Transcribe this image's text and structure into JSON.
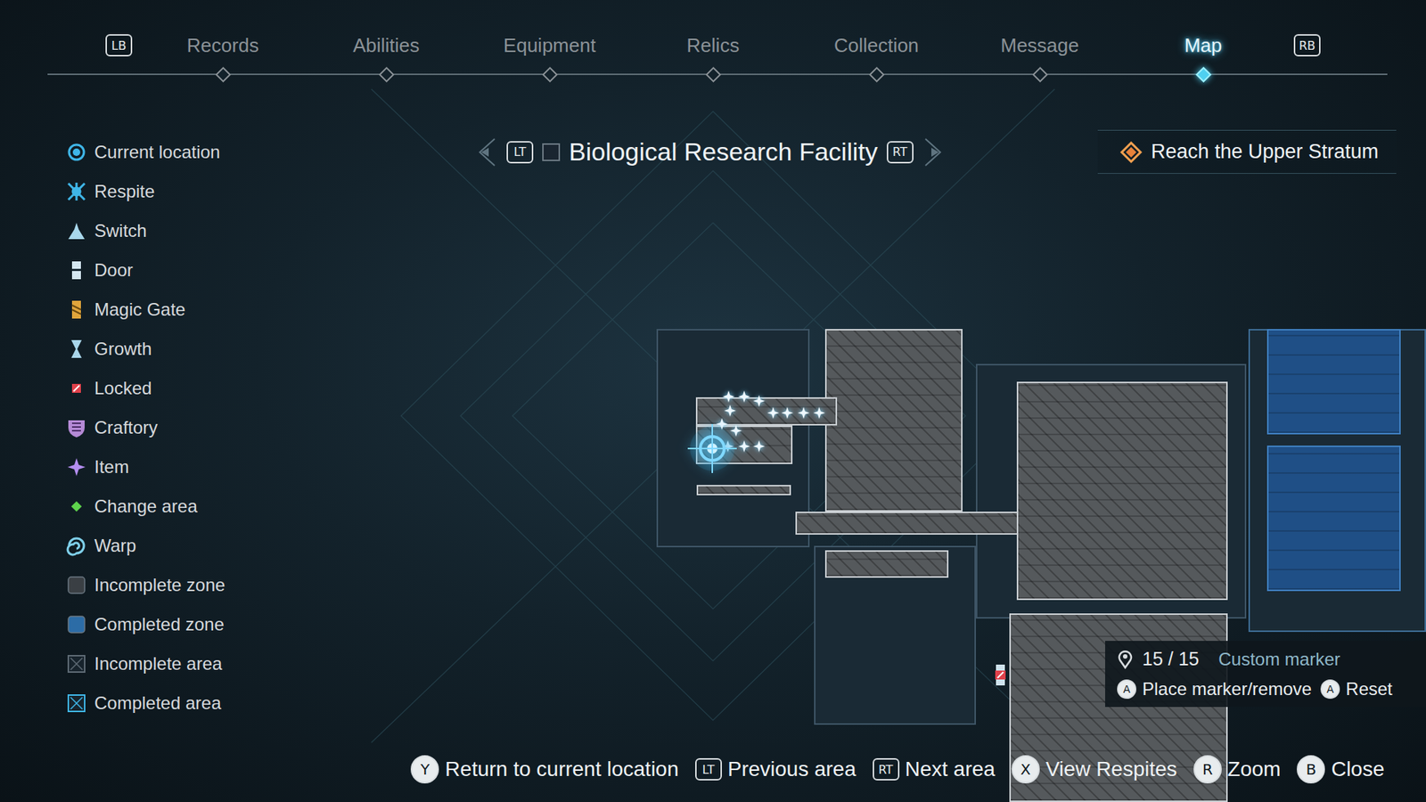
{
  "nav": {
    "prev_key": "LB",
    "next_key": "RB",
    "tabs": [
      {
        "label": "Records",
        "selected": false
      },
      {
        "label": "Abilities",
        "selected": false
      },
      {
        "label": "Equipment",
        "selected": false
      },
      {
        "label": "Relics",
        "selected": false
      },
      {
        "label": "Collection",
        "selected": false
      },
      {
        "label": "Message",
        "selected": false
      },
      {
        "label": "Map",
        "selected": true
      }
    ]
  },
  "legend": [
    {
      "label": "Current location",
      "kind": "current",
      "color": "#3fb6e8"
    },
    {
      "label": "Respite",
      "kind": "respite",
      "color": "#3fb6e8"
    },
    {
      "label": "Switch",
      "kind": "switch",
      "color": "#a9d8ec"
    },
    {
      "label": "Door",
      "kind": "door",
      "color": "#d4e6f0"
    },
    {
      "label": "Magic Gate",
      "kind": "gate",
      "color": "#e0a53c"
    },
    {
      "label": "Growth",
      "kind": "growth",
      "color": "#a9d6ea"
    },
    {
      "label": "Locked",
      "kind": "locked",
      "color": "#e0404a"
    },
    {
      "label": "Craftory",
      "kind": "craftory",
      "color": "#b58ad6"
    },
    {
      "label": "Item",
      "kind": "item",
      "color": "#b48ef0"
    },
    {
      "label": "Change area",
      "kind": "change",
      "color": "#5ed34c"
    },
    {
      "label": "Warp",
      "kind": "warp",
      "color": "#7fd0ea"
    },
    {
      "label": "Incomplete zone",
      "kind": "zone",
      "color": "#3a3f44"
    },
    {
      "label": "Completed zone",
      "kind": "zone",
      "color": "#2c6ca6"
    },
    {
      "label": "Incomplete area",
      "kind": "area",
      "color": "#5d6a74"
    },
    {
      "label": "Completed area",
      "kind": "area",
      "color": "#3fb6e8"
    }
  ],
  "area": {
    "prev_key": "LT",
    "name": "Biological Research Facility",
    "next_key": "RT",
    "completed": false
  },
  "objective": {
    "label": "Reach the Upper Stratum"
  },
  "map": {
    "zones": [
      {
        "completed": false
      },
      {
        "completed": false
      },
      {
        "completed": false
      },
      {
        "completed": true
      }
    ],
    "rooms": [
      {
        "completed": false
      },
      {
        "completed": false
      },
      {
        "completed": false
      },
      {
        "completed": false
      },
      {
        "completed": false
      },
      {
        "completed": false
      },
      {
        "completed": false
      },
      {
        "completed": false
      },
      {
        "completed": true
      },
      {
        "completed": true
      }
    ],
    "items": [
      {
        "collected": false
      },
      {
        "collected": false
      },
      {
        "collected": false
      },
      {
        "collected": false
      },
      {
        "collected": false
      },
      {
        "collected": false
      },
      {
        "collected": false
      },
      {
        "collected": false
      },
      {
        "collected": false
      },
      {
        "collected": false
      },
      {
        "collected": false
      },
      {
        "collected": false
      },
      {
        "collected": false
      }
    ],
    "locked_doors": [
      {
        "locked": true
      }
    ]
  },
  "marker_panel": {
    "count": "15 / 15",
    "label": "Custom marker",
    "actions": [
      {
        "key": "A",
        "label": "Place marker/remove"
      },
      {
        "key": "A",
        "label": "Reset"
      }
    ]
  },
  "controls": [
    {
      "key": "Y",
      "label": "Return to current location"
    },
    {
      "key": "LT",
      "label": "Previous area"
    },
    {
      "key": "RT",
      "label": "Next area"
    },
    {
      "key": "X",
      "label": "View Respites"
    },
    {
      "key": "R",
      "label": "Zoom"
    },
    {
      "key": "B",
      "label": "Close"
    }
  ]
}
